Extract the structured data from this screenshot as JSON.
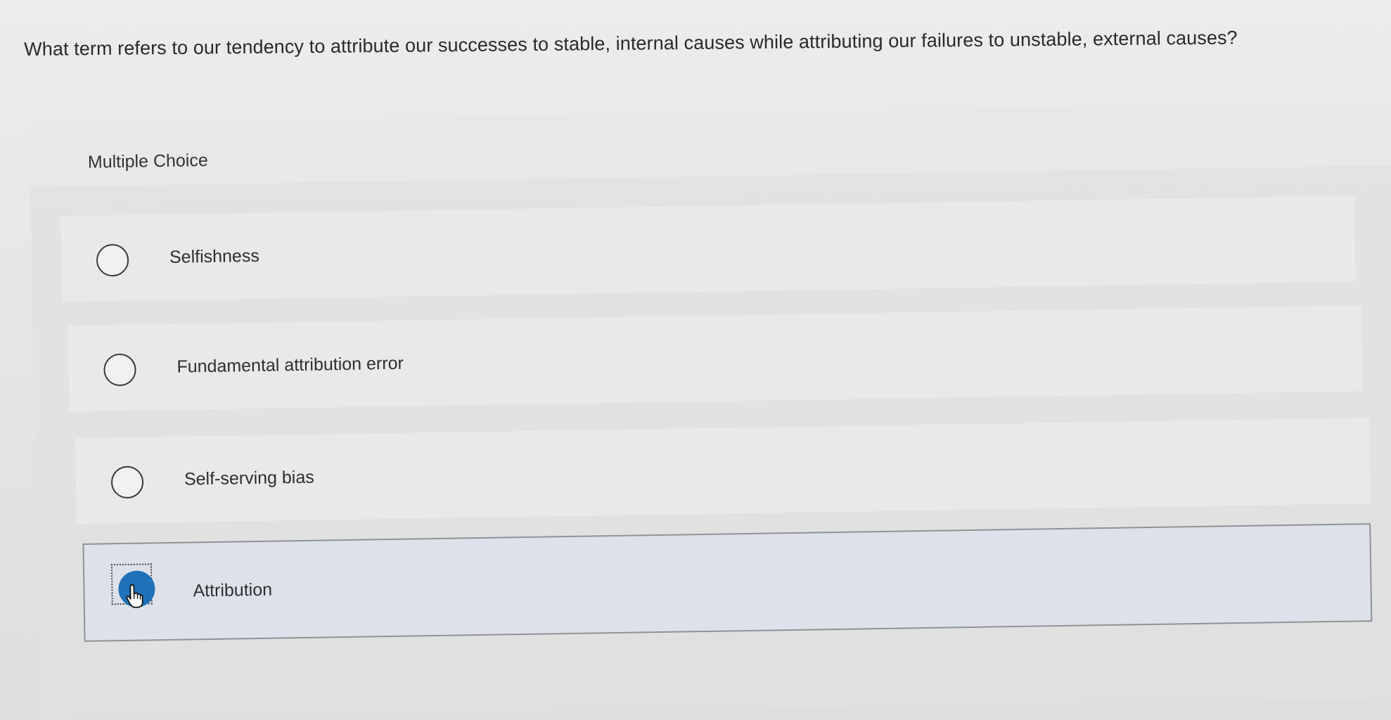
{
  "question": {
    "text": "What term refers to our tendency to attribute our successes to stable, internal causes while attributing our failures to unstable, external causes?"
  },
  "question_type": "Multiple Choice",
  "options": [
    {
      "label": "Selfishness",
      "selected": false
    },
    {
      "label": "Fundamental attribution error",
      "selected": false
    },
    {
      "label": "Self-serving bias",
      "selected": false
    },
    {
      "label": "Attribution",
      "selected": true
    }
  ],
  "colors": {
    "selected_radio": "#1f72b8",
    "selected_background": "#dde2ea"
  },
  "icons": {
    "cursor": "hand-pointer-icon"
  }
}
